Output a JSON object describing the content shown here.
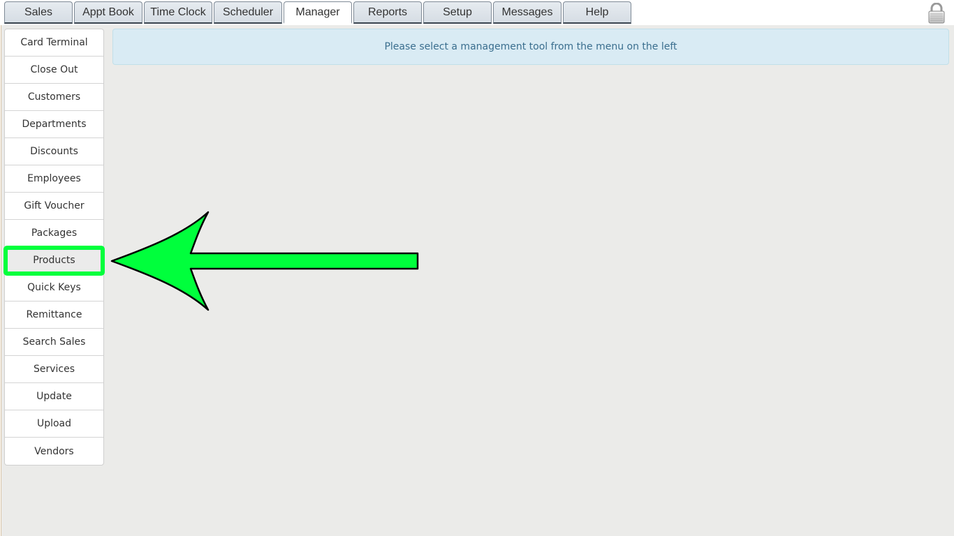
{
  "tabs": [
    {
      "label": "Sales",
      "active": false
    },
    {
      "label": "Appt Book",
      "active": false
    },
    {
      "label": "Time Clock",
      "active": false
    },
    {
      "label": "Scheduler",
      "active": false
    },
    {
      "label": "Manager",
      "active": true
    },
    {
      "label": "Reports",
      "active": false
    },
    {
      "label": "Setup",
      "active": false
    },
    {
      "label": "Messages",
      "active": false
    },
    {
      "label": "Help",
      "active": false
    }
  ],
  "header": {
    "lock_icon": "lock-icon"
  },
  "sidebar": {
    "items": [
      {
        "label": "Card Terminal"
      },
      {
        "label": "Close Out"
      },
      {
        "label": "Customers"
      },
      {
        "label": "Departments"
      },
      {
        "label": "Discounts"
      },
      {
        "label": "Employees"
      },
      {
        "label": "Gift Voucher"
      },
      {
        "label": "Packages"
      },
      {
        "label": "Products"
      },
      {
        "label": "Quick Keys"
      },
      {
        "label": "Remittance"
      },
      {
        "label": "Search Sales"
      },
      {
        "label": "Services"
      },
      {
        "label": "Update"
      },
      {
        "label": "Upload"
      },
      {
        "label": "Vendors"
      }
    ],
    "highlighted_item": "Products"
  },
  "main": {
    "message": "Please select a management tool from the menu on the left"
  },
  "annotation": {
    "icon": "arrow-left-icon",
    "color": "#00ff3c"
  }
}
